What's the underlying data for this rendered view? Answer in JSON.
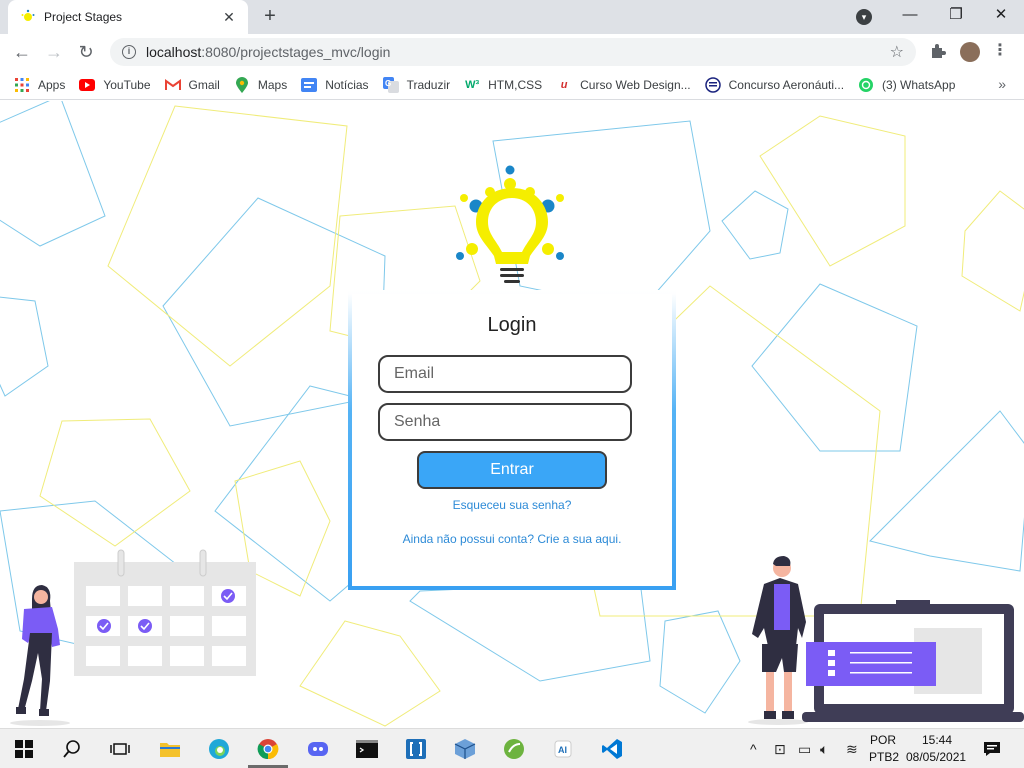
{
  "browser": {
    "tab_title": "Project Stages",
    "tab_close": "✕",
    "new_tab": "+",
    "url_host": "localhost",
    "url_path": ":8080/projectstages_mvc/login",
    "window_controls": {
      "minimize": "—",
      "maximize": "❐",
      "close": "✕"
    },
    "bookmarks": [
      {
        "label": "Apps",
        "icon": "apps-grid-icon",
        "color": "#ea4335"
      },
      {
        "label": "YouTube",
        "icon": "youtube-icon",
        "color": "#ff0000"
      },
      {
        "label": "Gmail",
        "icon": "gmail-icon",
        "color": "#ea4335"
      },
      {
        "label": "Maps",
        "icon": "maps-icon",
        "color": "#34a853"
      },
      {
        "label": "Notícias",
        "icon": "news-icon",
        "color": "#4285f4"
      },
      {
        "label": "Traduzir",
        "icon": "translate-icon",
        "color": "#4285f4"
      },
      {
        "label": "HTM,CSS",
        "icon": "w3-icon",
        "color": "#04aa6d"
      },
      {
        "label": "Curso Web Design...",
        "icon": "course-icon",
        "color": "#d32f2f"
      },
      {
        "label": "Concurso Aeronáuti...",
        "icon": "list-icon",
        "color": "#1a237e"
      },
      {
        "label": "(3) WhatsApp",
        "icon": "whatsapp-icon",
        "color": "#25d366"
      }
    ],
    "bookmarks_more": "»"
  },
  "login": {
    "title": "Login",
    "email_placeholder": "Email",
    "password_placeholder": "Senha",
    "submit_label": "Entrar",
    "forgot_link": "Esqueceu sua senha?",
    "signup_link": "Ainda não possui conta? Crie a sua aqui."
  },
  "colors": {
    "accent_blue": "#3aa6f7",
    "link_blue": "#2e8bd7",
    "bulb_yellow": "#f5ee00",
    "bulb_dot_blue": "#1a86c8",
    "pentagon_blue": "#7ec8ea",
    "pentagon_yellow": "#f0ec7a",
    "illustration_purple": "#7b5cf5"
  },
  "taskbar": {
    "language": "POR",
    "layout": "PTB2",
    "time": "15:44",
    "date": "08/05/2021"
  }
}
